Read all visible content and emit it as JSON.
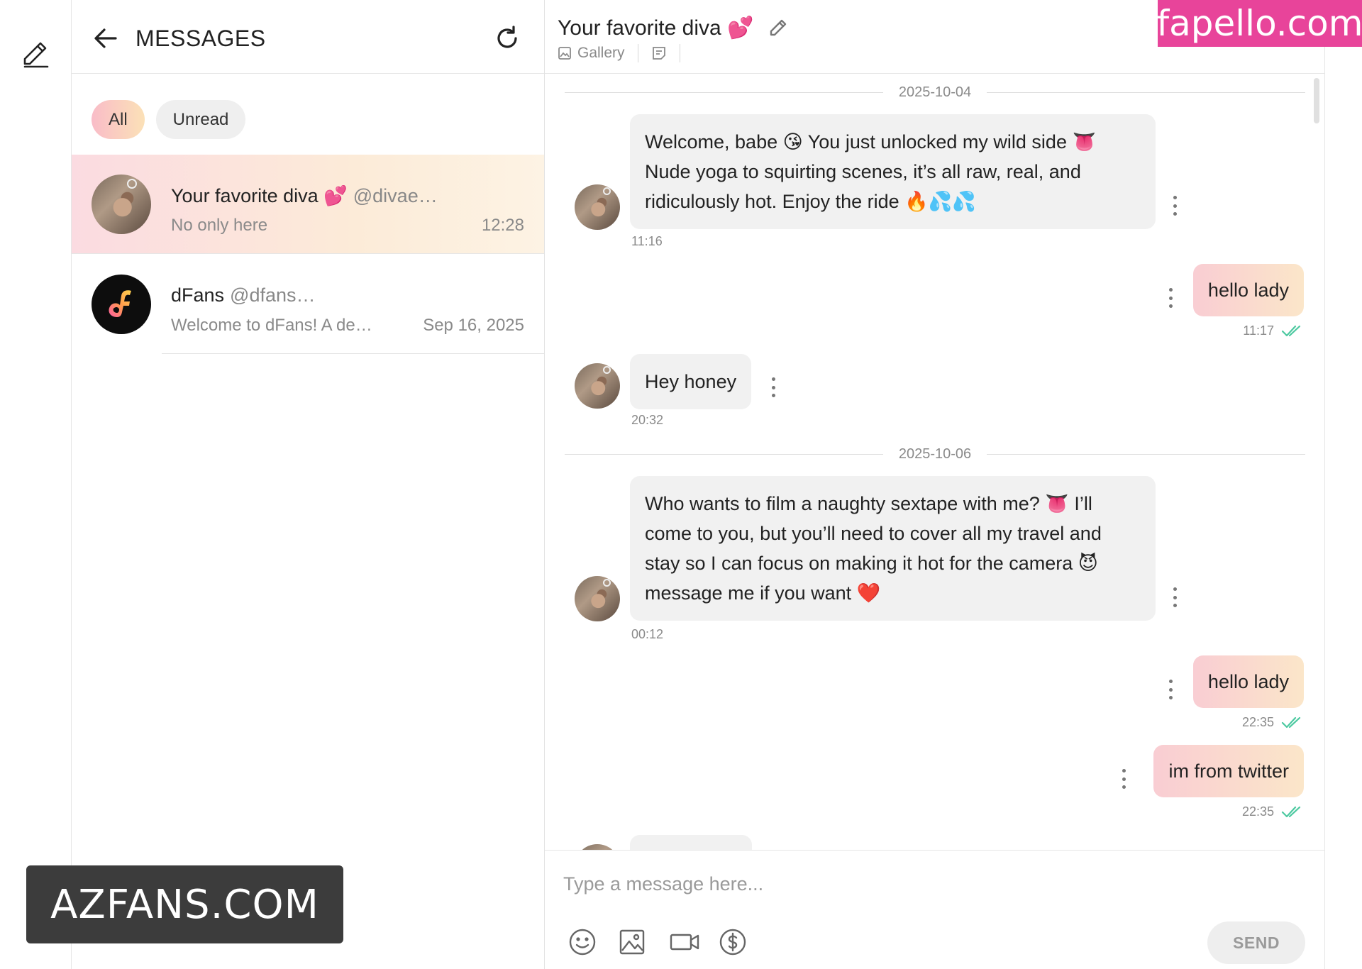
{
  "list": {
    "title": "MESSAGES",
    "filters": [
      {
        "label": "All",
        "active": true
      },
      {
        "label": "Unread",
        "active": false
      }
    ],
    "conversations": [
      {
        "name": "Your favorite diva 💕",
        "handle": "@divae…",
        "preview": "No only here",
        "time": "12:28",
        "selected": true
      },
      {
        "name": "dFans",
        "handle": "@dfans…",
        "preview": "Welcome to dFans! A de…",
        "time": "Sep 16, 2025",
        "selected": false
      }
    ]
  },
  "chat": {
    "title": "Your favorite diva 💕",
    "tabs": [
      {
        "label": "Gallery",
        "icon": "image-icon"
      },
      {
        "label": "",
        "icon": "notes-icon"
      }
    ],
    "dates": [
      "2025-10-04",
      "2025-10-06"
    ],
    "messages": [
      {
        "direction": "in",
        "lines": [
          "Welcome, babe 😘 You just unlocked my wild side 👅",
          "Nude yoga to squirting scenes, it’s all raw, real, and",
          "ridiculously hot. Enjoy the ride 🔥💦💦"
        ],
        "time": "11:16"
      },
      {
        "direction": "out",
        "text": "hello lady",
        "time": "11:17",
        "read": true
      },
      {
        "direction": "in",
        "lines": [
          "Hey honey"
        ],
        "time": "20:32"
      },
      {
        "direction": "in",
        "lines": [
          "Who wants to film a naughty sextape with me? 👅 I’ll",
          "come to you, but you’ll need to cover all my travel and",
          "stay so I can focus on making it hot for the camera 😈",
          "message me if you want ❤️"
        ],
        "time": "00:12"
      },
      {
        "direction": "out",
        "text": "hello lady",
        "time": "22:35",
        "read": true
      },
      {
        "direction": "out",
        "text": "im from twitter",
        "time": "22:35",
        "read": true
      }
    ],
    "composer": {
      "placeholder": "Type a message here...",
      "send_label": "SEND",
      "tools": [
        "emoji-icon",
        "image-icon",
        "video-icon",
        "dollar-icon"
      ]
    }
  },
  "watermarks": {
    "bottom_left": "AZFANS.COM",
    "top_right": "fapello.com"
  },
  "colors": {
    "accent_gradient_start": "#f9bcc8",
    "accent_gradient_end": "#fbe1b7",
    "read_check": "#4cc9a0",
    "watermark_pink": "#e8449a"
  }
}
